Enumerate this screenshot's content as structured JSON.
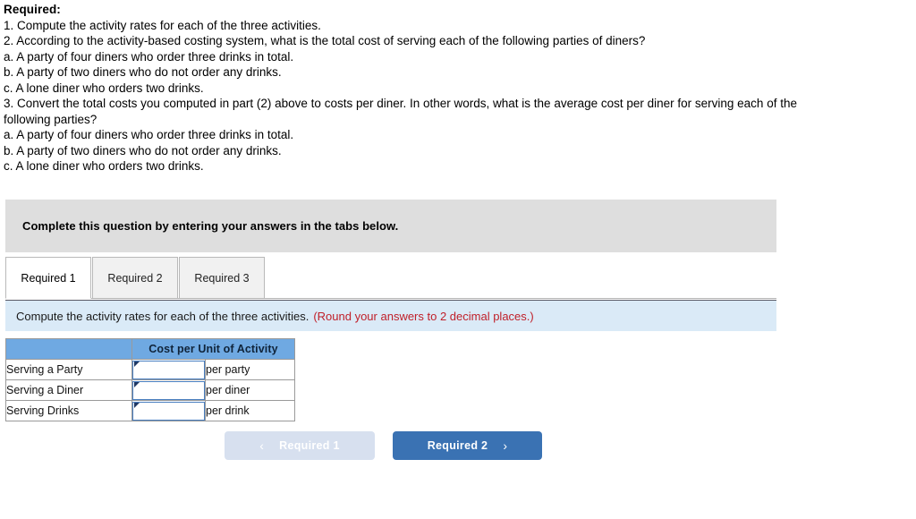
{
  "requirements": {
    "heading": "Required:",
    "lines": [
      "1. Compute the activity rates for each of the three activities.",
      "2. According to the activity-based costing system, what is the total cost of serving each of the following parties of diners?",
      "a. A party of four diners who order three drinks in total.",
      "b. A party of two diners who do not order any drinks.",
      "c. A lone diner who orders two drinks.",
      "3. Convert the total costs you computed in part (2) above to costs per diner. In other words, what is the average cost per diner for serving each of the following parties?",
      "a. A party of four diners who order three drinks in total.",
      "b. A party of two diners who do not order any drinks.",
      "c. A lone diner who orders two drinks."
    ]
  },
  "grey_banner": {
    "text": "Complete this question by entering your answers in the tabs below."
  },
  "tabs": [
    {
      "label": "Required 1",
      "active": true
    },
    {
      "label": "Required 2",
      "active": false
    },
    {
      "label": "Required 3",
      "active": false
    }
  ],
  "instruction_bar": {
    "text": "Compute the activity rates for each of the three activities.",
    "note": "(Round your answers to 2 decimal places.)",
    "note_color": "#c0202a",
    "background": "#daeaf7"
  },
  "answer_table": {
    "header_blank": "",
    "header_cost": "Cost per Unit of Activity",
    "header_background": "#6fa9e2",
    "rows": [
      {
        "label": "Serving a Party",
        "value": "",
        "unit": "per party"
      },
      {
        "label": "Serving a Diner",
        "value": "",
        "unit": "per diner"
      },
      {
        "label": "Serving Drinks",
        "value": "",
        "unit": "per drink"
      }
    ]
  },
  "navigation": {
    "prev": {
      "label": "Required 1",
      "icon": "chevron-left",
      "glyph": "‹",
      "disabled": true,
      "background": "#d7e0ef"
    },
    "next": {
      "label": "Required 2",
      "icon": "chevron-right",
      "glyph": "›",
      "disabled": false,
      "background": "#3a72b3"
    }
  }
}
